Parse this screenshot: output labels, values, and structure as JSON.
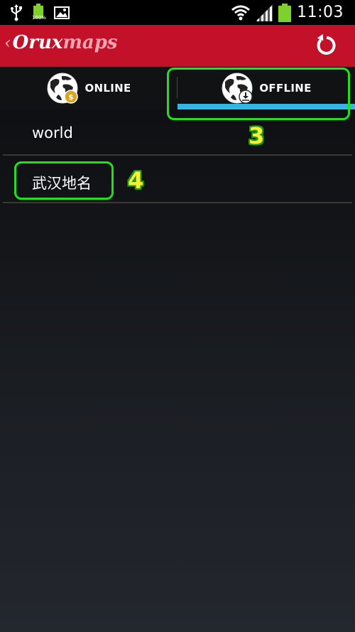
{
  "status_bar": {
    "time": "11:03",
    "battery_label": "100%",
    "icons": [
      "usb-icon",
      "battery-icon",
      "image-icon",
      "wifi-icon",
      "signal-icon",
      "battery-icon"
    ]
  },
  "app_bar": {
    "logo_part1": "Orux",
    "logo_part2": "maps",
    "logo_chevron": "‹",
    "action_icon": "refresh-icon",
    "color": "#c4112a"
  },
  "tabs": [
    {
      "label": "ONLINE",
      "icon": "globe-online-icon",
      "selected": false
    },
    {
      "label": "OFFLINE",
      "icon": "globe-offline-icon",
      "selected": true
    }
  ],
  "tab_indicator_color": "#33b5e5",
  "list": {
    "items": [
      {
        "label": "world"
      },
      {
        "label": "武汉地名"
      }
    ]
  },
  "annotations": {
    "offline_tab_number": "3",
    "list_item_number": "4",
    "frame_color": "#22e01c",
    "number_color": "#f7ef3a"
  }
}
